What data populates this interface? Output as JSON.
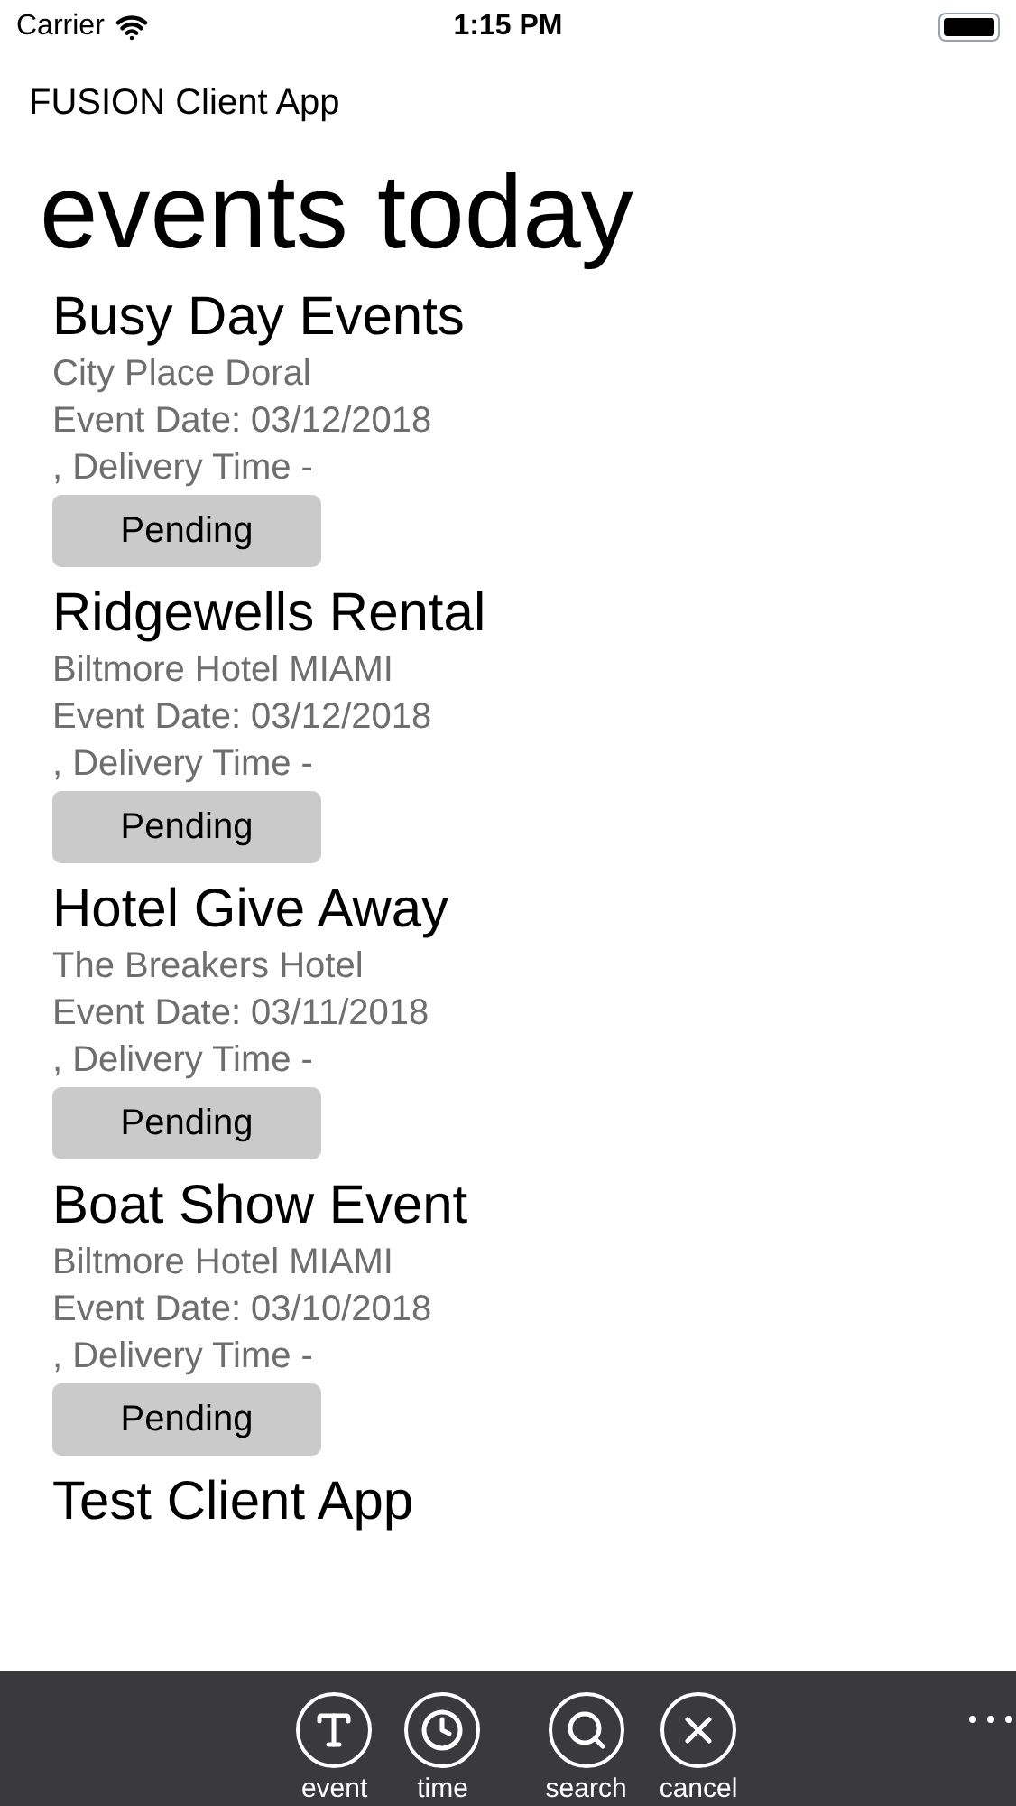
{
  "status_bar": {
    "carrier": "Carrier",
    "time": "1:15 PM"
  },
  "app_title": "FUSION Client App",
  "heading": "events today",
  "events": [
    {
      "title": "Busy Day Events",
      "venue": "City Place Doral",
      "date": "Event Date: 03/12/2018",
      "delivery": ", Delivery Time -",
      "status": "Pending"
    },
    {
      "title": "Ridgewells Rental",
      "venue": "Biltmore Hotel MIAMI",
      "date": "Event Date: 03/12/2018",
      "delivery": ", Delivery Time -",
      "status": "Pending"
    },
    {
      "title": "Hotel Give Away",
      "venue": "The Breakers Hotel",
      "date": "Event Date: 03/11/2018",
      "delivery": ", Delivery Time -",
      "status": "Pending"
    },
    {
      "title": "Boat Show Event",
      "venue": "Biltmore Hotel MIAMI",
      "date": "Event Date: 03/10/2018",
      "delivery": ", Delivery Time -",
      "status": "Pending"
    },
    {
      "title": "Test Client App"
    }
  ],
  "toolbar": [
    {
      "kind": "text",
      "label": "event"
    },
    {
      "kind": "clock",
      "label": "time"
    },
    {
      "kind": "search",
      "label": "search"
    },
    {
      "kind": "close",
      "label": "cancel"
    }
  ]
}
